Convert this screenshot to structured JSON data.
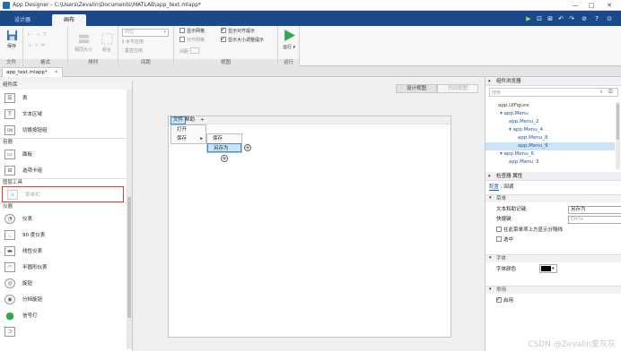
{
  "window": {
    "title": "App Designer - C:\\Users\\Zevalin\\Documents\\MATLAB\\app_text.mlapp*",
    "controls": [
      "—",
      "□",
      "✕"
    ]
  },
  "ribbon_tabs": [
    "设计器",
    "画布"
  ],
  "quick_access": [
    "▶",
    "⊡",
    "⊞",
    "↶",
    "↷",
    "⊘",
    "?",
    "⊙"
  ],
  "ribbon": {
    "file_group": {
      "label": "文件",
      "save": "保存"
    },
    "format_group": {
      "label": "格式"
    },
    "arrange_group": {
      "label": "排列",
      "same_size": "相同大小",
      "group": "组合"
    },
    "spacing_group": {
      "label": "间距",
      "dropdown_value": "均匀",
      "h_apply": "水平应用",
      "v_apply": "垂直应用"
    },
    "canvas_group": {
      "label": "视图",
      "show_grid": "显示网格",
      "show_align_hint": "显示对齐提示",
      "align_grid": "对齐网格",
      "show_resize_hint": "显示大小调整提示",
      "grid_spacing": "间距"
    },
    "run_group": {
      "label": "运行",
      "run": "运行"
    }
  },
  "file_tab": "app_text.mlapp*",
  "component_library": {
    "title": "组件库",
    "items_top": [
      {
        "icon": "☰",
        "label": "表"
      },
      {
        "icon": "T",
        "label": "文本区域"
      },
      {
        "icon": "ON",
        "label": "切换按钮组"
      }
    ],
    "cat_container": "容器",
    "containers": [
      {
        "icon": "▭",
        "label": "面板"
      },
      {
        "icon": "⊟",
        "label": "选项卡组"
      }
    ],
    "cat_figure_tools": "图窗工具",
    "figure_tools": [
      {
        "icon": "≡",
        "label": "菜单栏"
      }
    ],
    "cat_instruments": "仪器",
    "instruments": [
      {
        "icon": "◔",
        "label": "仪表"
      },
      {
        "icon": "◟",
        "label": "90 度仪表"
      },
      {
        "icon": "▬",
        "label": "线性仪表"
      },
      {
        "icon": "◠",
        "label": "半圆形仪表"
      },
      {
        "icon": "◎",
        "label": "旋钮"
      },
      {
        "icon": "◉",
        "label": "分档旋钮"
      },
      {
        "icon": "●",
        "label": "信号灯"
      },
      {
        "icon": "⊃",
        "label": ""
      }
    ]
  },
  "canvas": {
    "design_view": "设计视图",
    "code_view": "代码视图",
    "menubar": {
      "file": "文件",
      "help": "帮助",
      "add": "+"
    },
    "file_menu": {
      "open": "打开",
      "save": "保存"
    },
    "save_submenu": {
      "save": "保存",
      "save_as": "另存为"
    }
  },
  "browser": {
    "title": "组件浏览器",
    "search_placeholder": "搜索",
    "tree": [
      {
        "label": "app.UIFigure",
        "indent": 0,
        "selected": false,
        "root": true
      },
      {
        "label": "▾ app.Menu",
        "indent": 1,
        "selected": false,
        "root": false
      },
      {
        "label": "app.Menu_2",
        "indent": 2,
        "selected": false,
        "root": false
      },
      {
        "label": "▾ app.Menu_4",
        "indent": 2,
        "selected": false,
        "root": false
      },
      {
        "label": "app.Menu_8",
        "indent": 3,
        "selected": false,
        "root": false
      },
      {
        "label": "app.Menu_9",
        "indent": 3,
        "selected": true,
        "root": false
      },
      {
        "label": "▾ app.Menu_6",
        "indent": 1,
        "selected": false,
        "root": false
      },
      {
        "label": "app.Menu_3",
        "indent": 2,
        "selected": false,
        "root": false
      }
    ]
  },
  "inspector": {
    "title": "检查器 属性",
    "tab_config": "配置",
    "tab_callback": "回调",
    "sec_menu": "菜单",
    "text_label": "文本和助记键",
    "text_value": "另存为",
    "accel_label": "快捷键",
    "accel_placeholder": "Ctrl+",
    "separator_label": "在此菜单项上方显示分隔线",
    "checked_label": "选中",
    "sec_font": "字体",
    "font_color_label": "字体颜色",
    "font_color": "#000000",
    "sec_interactivity": "常用",
    "enabled_label": "启用"
  },
  "watermark": "CSDN @Zevalin爱灰灰",
  "colors": {
    "tab_strip": "#1a4a8a",
    "highlight": "#e0403c",
    "selection": "#cde4f8",
    "run_green": "#2fa84f"
  }
}
